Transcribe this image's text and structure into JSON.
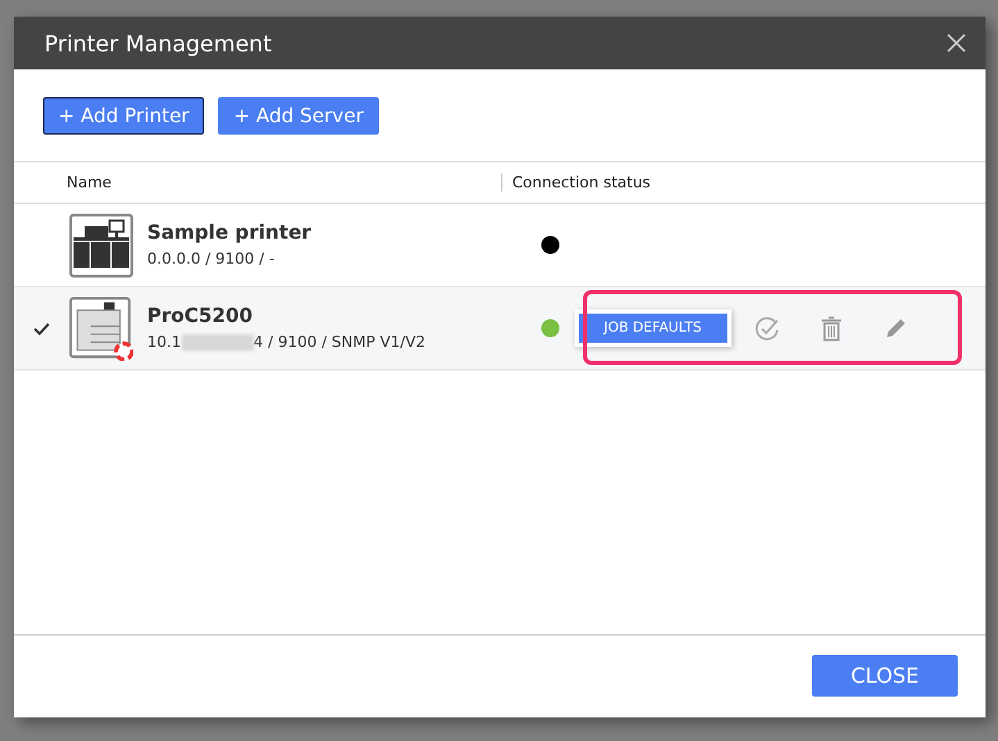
{
  "window": {
    "title": "Printer Management"
  },
  "toolbar": [
    "+ Add Printer",
    "+ Add Server"
  ],
  "table": {
    "columns": [
      "Name",
      "Connection status"
    ],
    "rows": [
      {
        "kind": "basic",
        "selected": false,
        "name": "Sample printer",
        "address": [
          "0.0.0.0 / 9100 / -"
        ],
        "color": "#000000",
        "highlighted": false
      },
      {
        "kind": "production",
        "selected": true,
        "name": "ProC5200",
        "address": [
          "10.1",
          "4 / 9100 / SNMP V1/V2"
        ],
        "color": "#7ac143",
        "highlighted": true,
        "action": "JOB DEFAULTS"
      }
    ]
  },
  "footer": {
    "button": "CLOSE"
  }
}
